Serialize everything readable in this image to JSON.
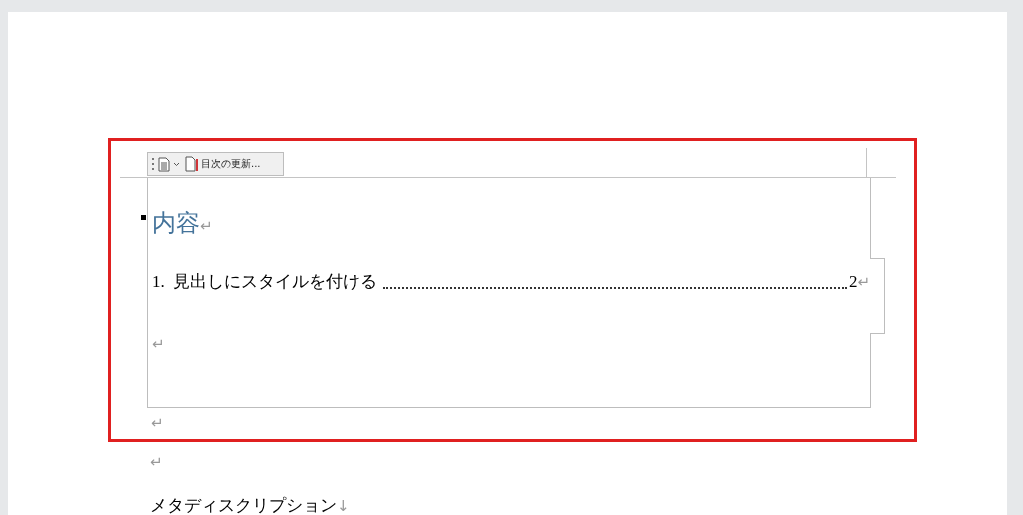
{
  "toc_control": {
    "toolbar": {
      "update_button": "目次の更新..."
    },
    "heading": "内容",
    "heading_mark": "↵",
    "entries": [
      {
        "number": "1.",
        "text": "見出しにスタイルを付ける",
        "page": "2",
        "mark": "↵"
      }
    ],
    "trailing_mark": "↵"
  },
  "paragraphs": [
    {
      "mark": "↵"
    },
    {
      "mark": "↵"
    },
    {
      "text": "メタディスクリプション",
      "mark": "↓"
    }
  ]
}
